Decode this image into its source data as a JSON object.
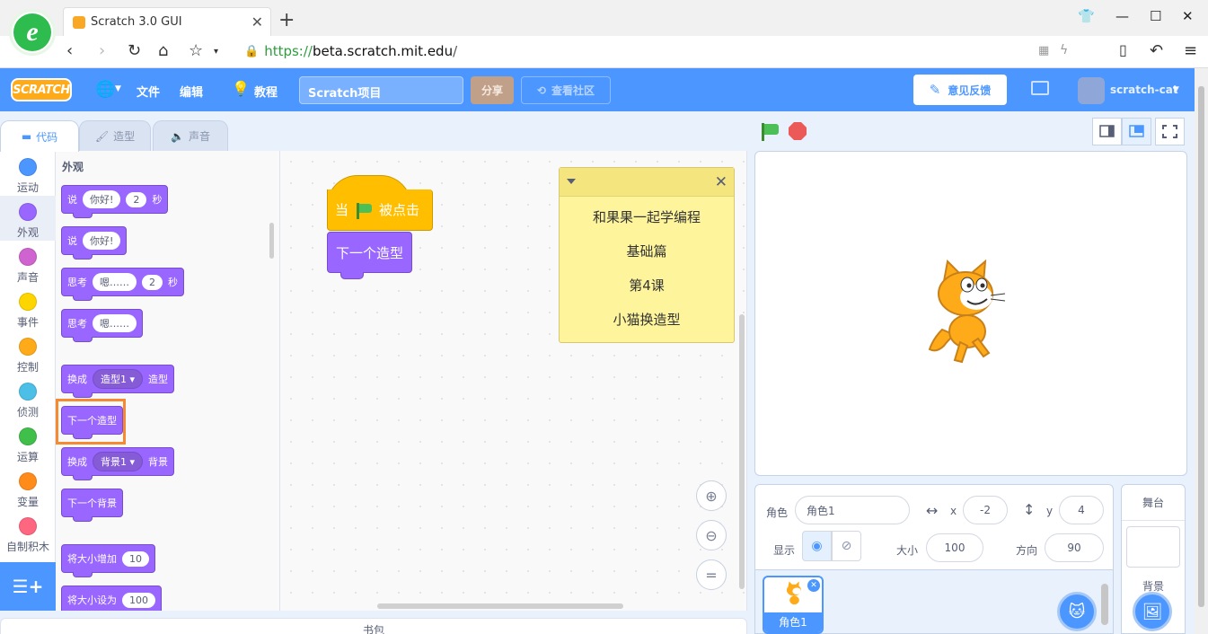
{
  "browser": {
    "tab_title": "Scratch 3.0 GUI",
    "url_protocol": "https://",
    "url_host": "beta.scratch.mit.edu",
    "url_path": "/"
  },
  "menu": {
    "logo_text": "SCRATCH",
    "file": "文件",
    "edit": "编辑",
    "tutorials": "教程",
    "project_title": "Scratch项目",
    "share": "分享",
    "see_community": "查看社区",
    "feedback": "意见反馈",
    "username": "scratch-cat"
  },
  "tabs": {
    "code": "代码",
    "costumes": "造型",
    "sounds": "声音"
  },
  "categories": [
    {
      "label": "运动",
      "color": "#4c97ff"
    },
    {
      "label": "外观",
      "color": "#9966ff"
    },
    {
      "label": "声音",
      "color": "#cf63cf"
    },
    {
      "label": "事件",
      "color": "#ffd500"
    },
    {
      "label": "控制",
      "color": "#ffab19"
    },
    {
      "label": "侦测",
      "color": "#4cbfe6"
    },
    {
      "label": "运算",
      "color": "#40bf4a"
    },
    {
      "label": "变量",
      "color": "#ff8c1a"
    },
    {
      "label": "自制积木",
      "color": "#ff6680"
    }
  ],
  "palette": {
    "title": "外观",
    "say_for": {
      "say": "说",
      "text": "你好!",
      "secs": "2",
      "unit": "秒"
    },
    "say": {
      "say": "说",
      "text": "你好!"
    },
    "think_for": {
      "think": "思考",
      "text": "嗯……",
      "secs": "2",
      "unit": "秒"
    },
    "think": {
      "think": "思考",
      "text": "嗯……"
    },
    "switch_costume": {
      "prefix": "换成",
      "value": "造型1",
      "suffix": "造型"
    },
    "next_costume": "下一个造型",
    "switch_backdrop": {
      "prefix": "换成",
      "value": "背景1",
      "suffix": "背景"
    },
    "next_backdrop": "下一个背景",
    "change_size": {
      "text": "将大小增加",
      "value": "10"
    },
    "set_size": {
      "text": "将大小设为",
      "value": "100"
    }
  },
  "workspace": {
    "hat_prefix": "当",
    "hat_suffix": "被点击",
    "stack_block": "下一个造型",
    "note_lines": [
      "和果果一起学编程",
      "基础篇",
      "第4课",
      "小猫换造型"
    ],
    "backpack": "书包"
  },
  "sprite_info": {
    "sprite_label": "角色",
    "sprite_name": "角色1",
    "x_label": "x",
    "x_value": "-2",
    "y_label": "y",
    "y_value": "4",
    "show_label": "显示",
    "size_label": "大小",
    "size_value": "100",
    "direction_label": "方向",
    "direction_value": "90"
  },
  "sprites": [
    {
      "name": "角色1"
    }
  ],
  "stage_panel": {
    "title": "舞台",
    "backdrop_label": "背景"
  }
}
